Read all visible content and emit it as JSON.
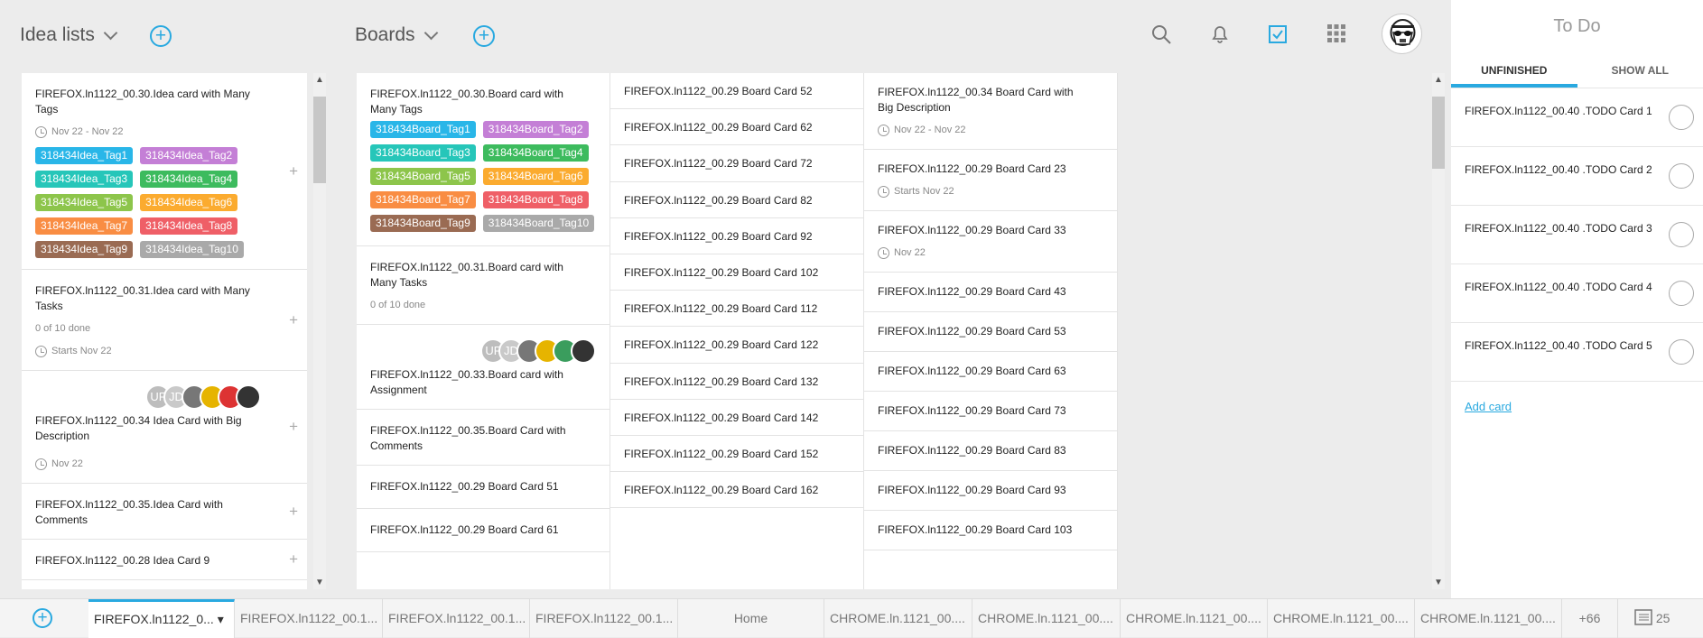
{
  "header": {
    "idea_lists_label": "Idea lists",
    "boards_label": "Boards"
  },
  "idea_cards": [
    {
      "title": "FIREFOX.ln1122_00.30.Idea card with Many Tags",
      "date": "Nov 22 - Nov 22",
      "tags": [
        "318434Idea_Tag1",
        "318434Idea_Tag2",
        "318434Idea_Tag3",
        "318434Idea_Tag4",
        "318434Idea_Tag5",
        "318434Idea_Tag6",
        "318434Idea_Tag7",
        "318434Idea_Tag8",
        "318434Idea_Tag9",
        "318434Idea_Tag10"
      ]
    },
    {
      "title": "FIREFOX.ln1122_00.31.Idea card with Many Tasks",
      "tasks": "0 of 10 done",
      "date": "Starts Nov 22"
    },
    {
      "title": "FIREFOX.ln1122_00.34 Idea Card with Big Description",
      "date": "Nov 22",
      "avatars": [
        "UF",
        "JD"
      ]
    },
    {
      "title": "FIREFOX.ln1122_00.35.Idea Card with Comments"
    },
    {
      "title": "FIREFOX.ln1122_00.28 Idea Card 9"
    }
  ],
  "board_col1": [
    {
      "title": "FIREFOX.ln1122_00.30.Board card with Many Tags",
      "tags": [
        "318434Board_Tag1",
        "318434Board_Tag2",
        "318434Board_Tag3",
        "318434Board_Tag4",
        "318434Board_Tag5",
        "318434Board_Tag6",
        "318434Board_Tag7",
        "318434Board_Tag8",
        "318434Board_Tag9",
        "318434Board_Tag10"
      ]
    },
    {
      "title": "FIREFOX.ln1122_00.31.Board card with Many Tasks",
      "tasks": "0 of 10 done"
    },
    {
      "title": "FIREFOX.ln1122_00.33.Board card with Assignment",
      "avatars": [
        "UF",
        "JD"
      ]
    },
    {
      "title": "FIREFOX.ln1122_00.35.Board Card with Comments"
    },
    {
      "title": "FIREFOX.ln1122_00.29 Board Card 51"
    },
    {
      "title": "FIREFOX.ln1122_00.29 Board Card 61"
    }
  ],
  "board_col2": [
    "FIREFOX.ln1122_00.29 Board Card 52",
    "FIREFOX.ln1122_00.29 Board Card 62",
    "FIREFOX.ln1122_00.29 Board Card 72",
    "FIREFOX.ln1122_00.29 Board Card 82",
    "FIREFOX.ln1122_00.29 Board Card 92",
    "FIREFOX.ln1122_00.29 Board Card 102",
    "FIREFOX.ln1122_00.29 Board Card 112",
    "FIREFOX.ln1122_00.29 Board Card 122",
    "FIREFOX.ln1122_00.29 Board Card 132",
    "FIREFOX.ln1122_00.29 Board Card 142",
    "FIREFOX.ln1122_00.29 Board Card 152",
    "FIREFOX.ln1122_00.29 Board Card 162"
  ],
  "board_col3": [
    {
      "title": "FIREFOX.ln1122_00.34 Board Card with Big Description",
      "date": "Nov 22 - Nov 22"
    },
    {
      "title": "FIREFOX.ln1122_00.29 Board Card 23",
      "date": "Starts Nov 22"
    },
    {
      "title": "FIREFOX.ln1122_00.29 Board Card 33",
      "date": "Nov 22"
    },
    {
      "title": "FIREFOX.ln1122_00.29 Board Card 43"
    },
    {
      "title": "FIREFOX.ln1122_00.29 Board Card 53"
    },
    {
      "title": "FIREFOX.ln1122_00.29 Board Card 63"
    },
    {
      "title": "FIREFOX.ln1122_00.29 Board Card 73"
    },
    {
      "title": "FIREFOX.ln1122_00.29 Board Card 83"
    },
    {
      "title": "FIREFOX.ln1122_00.29 Board Card 93"
    },
    {
      "title": "FIREFOX.ln1122_00.29 Board Card 103"
    }
  ],
  "todo": {
    "title": "To Do",
    "tab_unfinished": "UNFINISHED",
    "tab_show_all": "SHOW ALL",
    "items": [
      "FIREFOX.ln1122_00.40 .TODO Card 1",
      "FIREFOX.ln1122_00.40 .TODO Card 2",
      "FIREFOX.ln1122_00.40 .TODO Card 3",
      "FIREFOX.ln1122_00.40 .TODO Card 4",
      "FIREFOX.ln1122_00.40 .TODO Card 5"
    ],
    "add_card": "Add card"
  },
  "tabbar": {
    "tabs": [
      "FIREFOX.ln1122_0...",
      "FIREFOX.ln1122_00.1...",
      "FIREFOX.ln1122_00.1...",
      "FIREFOX.ln1122_00.1...",
      "Home",
      "CHROME.ln.1121_00....",
      "CHROME.ln.1121_00....",
      "CHROME.ln.1121_00....",
      "CHROME.ln.1121_00....",
      "CHROME.ln.1121_00...."
    ],
    "more": "+66",
    "count": "25"
  },
  "colors": {
    "accent": "#29a9e0"
  },
  "tag_colors": [
    "#29b6e8",
    "#c47fd6",
    "#26c6b9",
    "#3dbb5e",
    "#8dc54b",
    "#fbab2f",
    "#f98d43",
    "#ef5f67",
    "#9a6b53",
    "#a9a9a9"
  ]
}
